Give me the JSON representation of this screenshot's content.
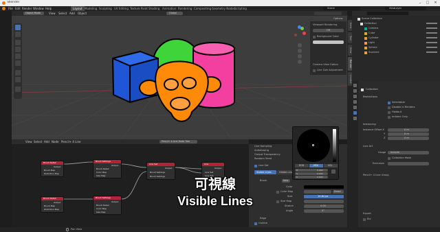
{
  "titlebar": {
    "app_title": "Blender"
  },
  "topbar": {
    "menus": [
      "File",
      "Edit",
      "Render",
      "Window",
      "Help"
    ],
    "workspaces": [
      "Layout",
      "Modeling",
      "Sculpting",
      "UV Editing",
      "Texture Paint",
      "Shading",
      "Animation",
      "Rendering",
      "Compositing",
      "Geometry Nodes",
      "Scripting"
    ],
    "scene": "Scene",
    "view_layer": "ViewLayer"
  },
  "viewport": {
    "mode": "Object Mode",
    "menus": [
      "View",
      "Select",
      "Add",
      "Object"
    ],
    "orientation": "Global",
    "options_label": "Options",
    "render_panel": {
      "title": "Viewport Rendering",
      "off_label": "Off",
      "background_color": "Background Color",
      "camera_view_option": "Camera View Option",
      "line_size_adjustment": "Line Size Adjustment"
    },
    "side_tabs": [
      "Item",
      "Tool",
      "View",
      "Render",
      "LineArt"
    ]
  },
  "outliner": {
    "title": "Scene Collection",
    "items": [
      "Collection",
      "Camera",
      "Cube",
      "Cylinder",
      "Light",
      "Sphere",
      "Suzanne"
    ]
  },
  "properties": {
    "collection_label": "Collection",
    "restrictions": {
      "title": "Restrictions",
      "selectable": "Selectable",
      "disable_in_renders": "Disable in Renders",
      "holdout": "Holdout",
      "indirect_only": "Indirect Only"
    },
    "instancing": {
      "title": "Instancing",
      "offset_label": "Instance Offset X",
      "y": "Y",
      "z": "Z",
      "x_value": "0 m",
      "y_value": "0 m",
      "z_value": "0 m"
    },
    "line_art": {
      "title": "Line Art",
      "usage_label": "Usage",
      "usage_value": "Include",
      "collection_mask": "Collection Mask",
      "exclusion_label": "Exclusion"
    },
    "lineset": {
      "title": "Pencil+ 4 Line Group"
    },
    "export": {
      "title": "Export",
      "label": "Etc"
    }
  },
  "node_editor": {
    "menus": [
      "View",
      "Select",
      "Add",
      "Node"
    ],
    "tree_name": "Pencil+ 4 Line Node Tree",
    "header_label": "Pencil+ 4 Line",
    "footer": "Pan View",
    "nodes": [
      {
        "title": "Brush Detail",
        "output": "Output",
        "inputs": [
          "Brush Map",
          "Distortion Map"
        ]
      },
      {
        "title": "Brush Settings",
        "output": "Output",
        "inputs": [
          "Brush Detail",
          "Color Map",
          "Size Map"
        ]
      },
      {
        "title": "Line Set",
        "output": "Output",
        "inputs": [
          "Brush Settings",
          "Brush Settings"
        ]
      },
      {
        "title": "Line",
        "output": "Output",
        "inputs": [
          "Line Set",
          "Line Set"
        ]
      },
      {
        "title": "Brush Detail",
        "output": "Output",
        "inputs": [
          "Brush Map",
          "Distortion Map"
        ]
      },
      {
        "title": "Brush Settings",
        "output": "Output",
        "inputs": [
          "Brush Detail",
          "Color Map",
          "Size Map"
        ]
      }
    ]
  },
  "line_panel": {
    "rows": [
      "Line Sampling",
      "Antialiasing",
      "Output Transparency",
      "Random Seed"
    ],
    "line_set_label": "Line Set",
    "tabs": [
      "Visible Lines",
      "Hidden Lines"
    ],
    "brush_label": "Brush",
    "color_label": "Color",
    "color_map_label": "Color Map",
    "size_label": "Size",
    "size_value": "10.84 px",
    "size_map_label": "Size Map",
    "stretch_label": "Stretch",
    "stretch_value": "0.00",
    "angle_label": "Angle",
    "angle_value": "0°",
    "edge_label": "Edge",
    "outline_label": "Outline",
    "new_label": "New",
    "detail_label": "Detail"
  },
  "color_picker": {
    "modes": [
      "RGB",
      "HSV",
      "HSL"
    ],
    "fields": [
      "H",
      "S",
      "V"
    ],
    "values": [
      "0.000",
      "0.000",
      "0.000"
    ],
    "hex_label": "Hex",
    "alpha_label": "A",
    "alpha_value": "1.000"
  },
  "subtitle": {
    "line1": "可視線",
    "line2": "Visible Lines"
  },
  "colors": {
    "cube": "#1f55d6",
    "sphere": "#3ed43a",
    "cylinder": "#f23fa0",
    "monkey": "#ff8a0a",
    "node_header": "#b0243a",
    "active_tab": "#4772b3"
  }
}
